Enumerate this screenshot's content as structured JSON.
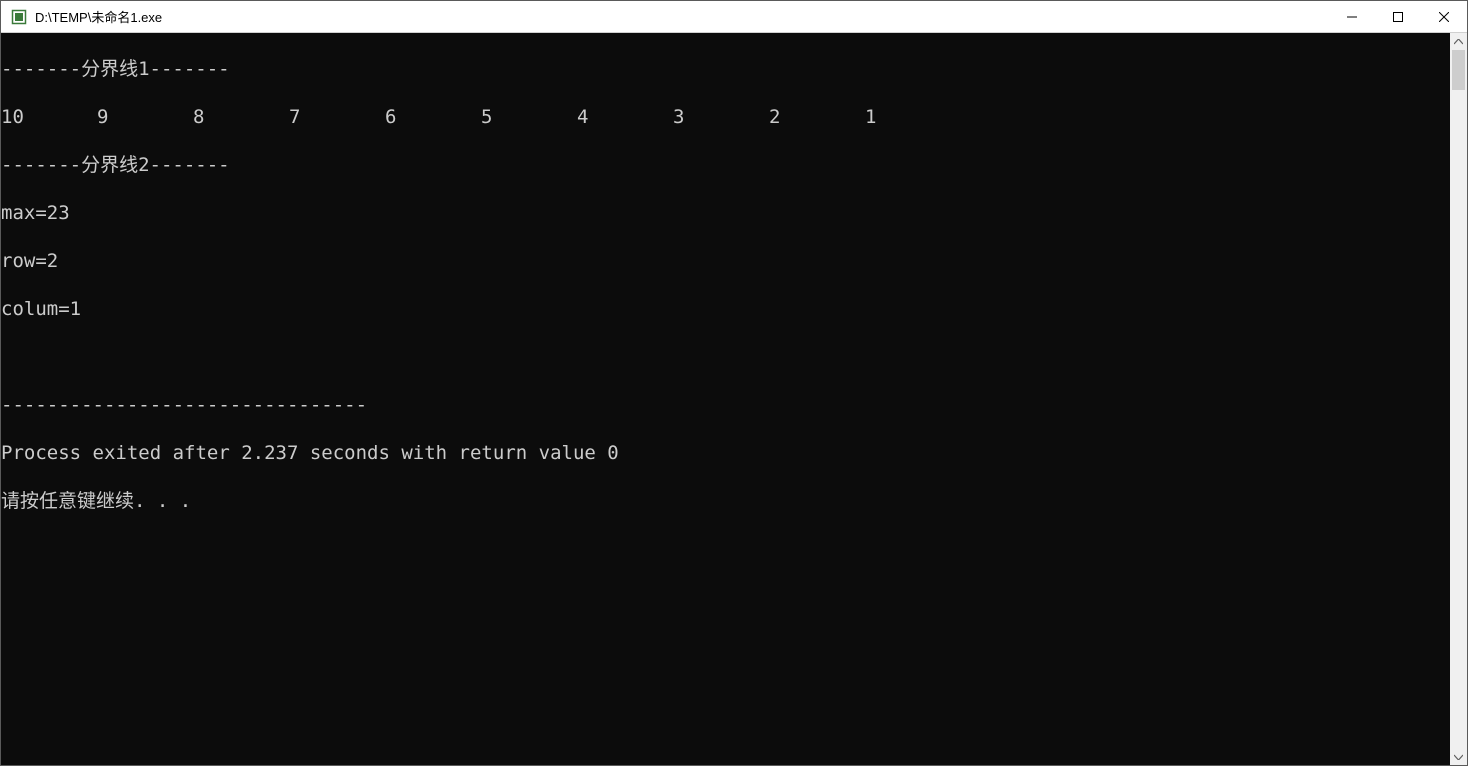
{
  "window": {
    "title": "D:\\TEMP\\未命名1.exe"
  },
  "console": {
    "divider1": "-------分界线1-------",
    "numbers": [
      "10",
      "9",
      "8",
      "7",
      "6",
      "5",
      "4",
      "3",
      "2",
      "1"
    ],
    "divider2": "-------分界线2-------",
    "max_line": "max=23",
    "row_line": "row=2",
    "colum_line": "colum=1",
    "blank": "",
    "hr": "--------------------------------",
    "exit_line": "Process exited after 2.237 seconds with return value 0",
    "continue_line": "请按任意键继续. . ."
  }
}
